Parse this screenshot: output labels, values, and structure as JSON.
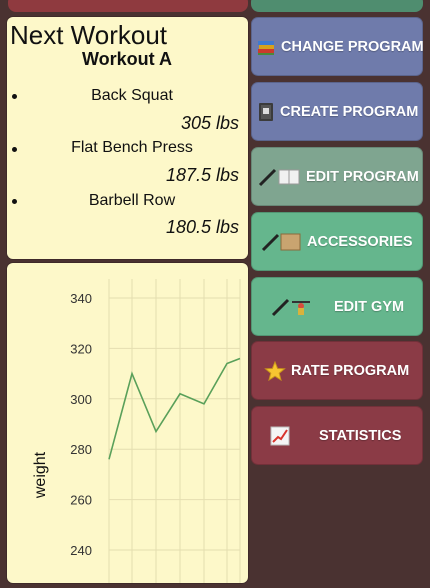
{
  "next_workout": {
    "title": "Next Workout",
    "subtitle": "Workout A",
    "exercises": [
      {
        "name": "Back Squat",
        "weight": "305 lbs"
      },
      {
        "name": "Flat Bench Press",
        "weight": "187.5 lbs"
      },
      {
        "name": "Barbell Row",
        "weight": "180.5 lbs"
      }
    ]
  },
  "menu": {
    "change_program": "CHANGE PROGRAM",
    "create_program": "CREATE PROGRAM",
    "edit_program": "EDIT PROGRAM",
    "accessories": "ACCESSORIES",
    "edit_gym": "EDIT GYM",
    "rate_program": "RATE PROGRAM",
    "statistics": "STATISTICS"
  },
  "colors": {
    "background": "#4a3231",
    "card": "#fdf8c9",
    "purple_button": "#6f7bab",
    "green_button": "#65b68d",
    "red_button": "#8b3b46",
    "line": "#5aa05a"
  },
  "icons": {
    "change_program": "books-icon",
    "create_program": "notebook-icon",
    "edit_program": "pen-and-book-icon",
    "accessories": "pen-and-scroll-icon",
    "edit_gym": "pen-and-weightlifter-icon",
    "rate_program": "star-icon",
    "statistics": "chart-increasing-icon"
  },
  "chart_data": {
    "type": "line",
    "ylabel": "weight",
    "xlabel": "",
    "ylim": [
      235,
      345
    ],
    "yticks": [
      240,
      260,
      280,
      300,
      320,
      340
    ],
    "grid": true,
    "series": [
      {
        "values": [
          276,
          310,
          287,
          302,
          298,
          314,
          316
        ]
      }
    ]
  }
}
